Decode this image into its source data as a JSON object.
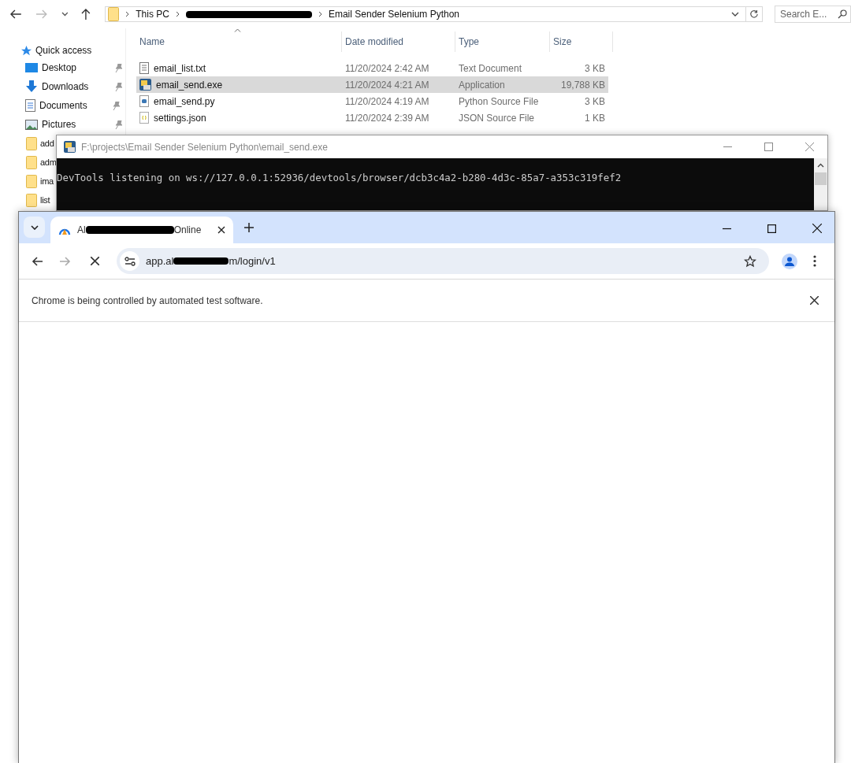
{
  "explorer": {
    "breadcrumb": [
      "This PC",
      "Email Sender Selenium Python"
    ],
    "search": {
      "placeholder": "Search E..."
    },
    "sidebar": {
      "quick_access": "Quick access",
      "pinned": [
        {
          "label": "Desktop",
          "kind": "desktop"
        },
        {
          "label": "Downloads",
          "kind": "downloads"
        },
        {
          "label": "Documents",
          "kind": "documents"
        },
        {
          "label": "Pictures",
          "kind": "pictures"
        }
      ],
      "folders": [
        "add",
        "adm",
        "ima",
        "list"
      ]
    },
    "columns": [
      "Name",
      "Date modified",
      "Type",
      "Size"
    ],
    "files": [
      {
        "name": "email_list.txt",
        "date": "11/20/2024 2:42 AM",
        "type": "Text Document",
        "size": "3 KB",
        "kind": "text",
        "selected": false
      },
      {
        "name": "email_send.exe",
        "date": "11/20/2024 4:21 AM",
        "type": "Application",
        "size": "19,788 KB",
        "kind": "exe",
        "selected": true
      },
      {
        "name": "email_send.py",
        "date": "11/20/2024 4:19 AM",
        "type": "Python Source File",
        "size": "3 KB",
        "kind": "py",
        "selected": false
      },
      {
        "name": "settings.json",
        "date": "11/20/2024 2:39 AM",
        "type": "JSON Source File",
        "size": "1 KB",
        "kind": "json",
        "selected": false
      }
    ]
  },
  "console": {
    "title": "F:\\projects\\Email Sender Selenium Python\\email_send.exe",
    "lines": [
      "DevTools listening on ws://127.0.0.1:52936/devtools/browser/dcb3c4a2-b280-4d3c-85a7-a353c319fef2"
    ]
  },
  "browser": {
    "tab": {
      "title_start": "Al",
      "title_end": "Online",
      "selected": true
    },
    "url_start": "app.al",
    "url_end": "m/login/v1",
    "infobar": "Chrome is being controlled by automated test software."
  }
}
